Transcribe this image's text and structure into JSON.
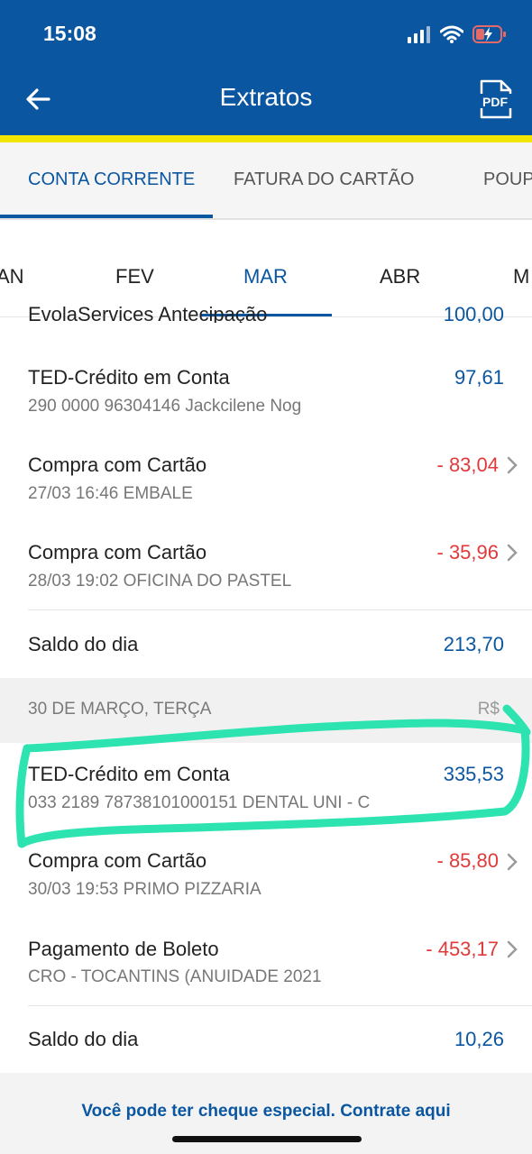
{
  "status_bar": {
    "time": "15:08",
    "icons": [
      "signal-icon",
      "wifi-icon",
      "battery-charging-icon"
    ]
  },
  "header": {
    "title": "Extratos",
    "back_icon": "back-arrow-icon",
    "pdf_icon": "pdf-icon",
    "pdf_label": "PDF",
    "bg_color": "#0a56a0",
    "accent_color": "#f2e500"
  },
  "tabs": [
    {
      "label": "CONTA CORRENTE",
      "active": true
    },
    {
      "label": "FATURA DO CARTÃO",
      "active": false
    },
    {
      "label": "POUPA",
      "active": false
    }
  ],
  "months": [
    {
      "label": "AN",
      "active": false
    },
    {
      "label": "FEV",
      "active": false
    },
    {
      "label": "MAR",
      "active": true
    },
    {
      "label": "ABR",
      "active": false
    },
    {
      "label": "M",
      "active": false
    }
  ],
  "cut_row": {
    "title": "EvolaServices Antecipação",
    "amount": "100,00"
  },
  "transactions_a": [
    {
      "title": "TED-Crédito em Conta",
      "subtitle": "290 0000      96304146 Jackcilene Nog",
      "amount": "97,61",
      "type": "credit"
    },
    {
      "title": "Compra com Cartão",
      "subtitle": "27/03 16:46 EMBALE",
      "amount": "- 83,04",
      "type": "debit"
    },
    {
      "title": "Compra com Cartão",
      "subtitle": "28/03 19:02 OFICINA DO PASTEL",
      "amount": "- 35,96",
      "type": "debit"
    }
  ],
  "balance_a": {
    "label": "Saldo do dia",
    "amount": "213,70"
  },
  "date_header": {
    "date": "30 DE MARÇO, TERÇA",
    "currency": "R$"
  },
  "transactions_b": [
    {
      "title": "TED-Crédito em Conta",
      "subtitle": "033 2189 78738101000151 DENTAL UNI - C",
      "amount": "335,53",
      "type": "credit"
    },
    {
      "title": "Compra com Cartão",
      "subtitle": "30/03 19:53 PRIMO PIZZARIA",
      "amount": "- 85,80",
      "type": "debit"
    },
    {
      "title": "Pagamento de Boleto",
      "subtitle": "CRO - TOCANTINS (ANUIDADE 2021",
      "amount": "- 453,17",
      "type": "debit"
    }
  ],
  "balance_b": {
    "label": "Saldo do dia",
    "amount": "10,26"
  },
  "promo": {
    "text": "Você pode ter cheque especial. Contrate aqui"
  },
  "colors": {
    "credit": "#0a56a0",
    "debit": "#e03a3a",
    "highlight": "#2de3b0"
  }
}
